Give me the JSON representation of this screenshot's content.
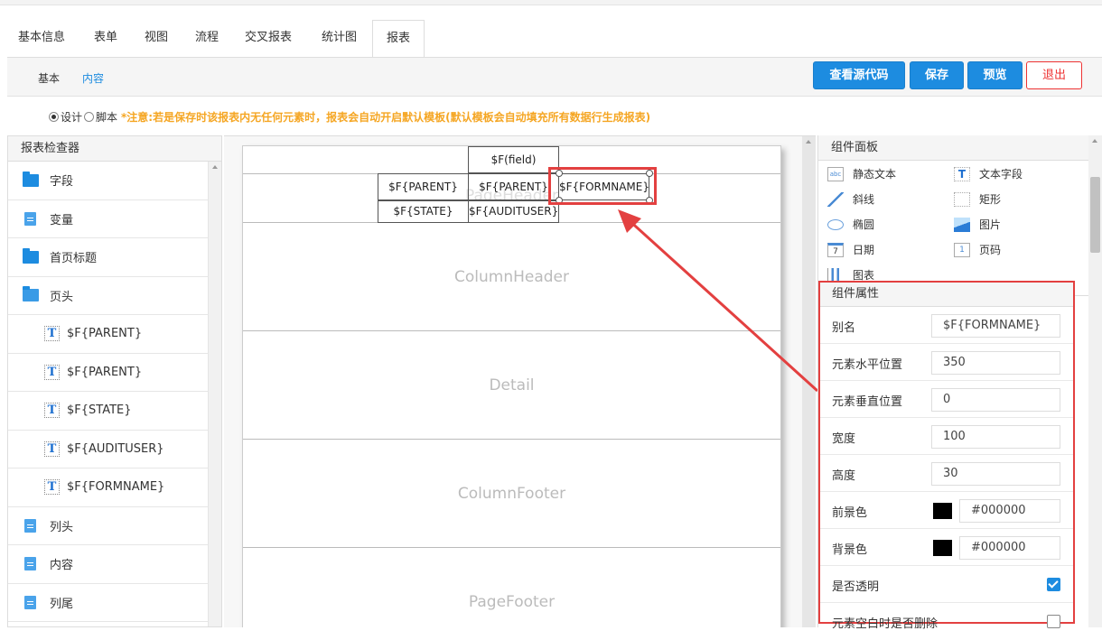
{
  "tabs": [
    {
      "label": "基本信息"
    },
    {
      "label": "表单"
    },
    {
      "label": "视图"
    },
    {
      "label": "流程"
    },
    {
      "label": "交叉报表"
    },
    {
      "label": "统计图"
    },
    {
      "label": "报表",
      "active": true
    }
  ],
  "subnav": {
    "basic": "基本",
    "content": "内容"
  },
  "buttons": {
    "view_source": "查看源代码",
    "save": "保存",
    "preview": "预览",
    "exit": "退出"
  },
  "mode": {
    "design": "设计",
    "script": "脚本",
    "selected": "设计",
    "notice": "*注意:若是保存时该报表内无任何元素时，报表会自动开启默认模板(默认模板会自动填充所有数据行生成报表)"
  },
  "inspector": {
    "title": "报表检查器",
    "items": [
      {
        "label": "字段",
        "icon": "folder-icon",
        "child": false
      },
      {
        "label": "变量",
        "icon": "document-icon",
        "child": false
      },
      {
        "label": "首页标题",
        "icon": "folder-icon",
        "child": false
      },
      {
        "label": "页头",
        "icon": "folder-open-icon",
        "child": false
      },
      {
        "label": "$F{PARENT}",
        "icon": "text-field-icon",
        "child": true
      },
      {
        "label": "$F{PARENT}",
        "icon": "text-field-icon",
        "child": true
      },
      {
        "label": "$F{STATE}",
        "icon": "text-field-icon",
        "child": true
      },
      {
        "label": "$F{AUDITUSER}",
        "icon": "text-field-icon",
        "child": true
      },
      {
        "label": "$F{FORMNAME}",
        "icon": "text-field-icon",
        "child": true
      },
      {
        "label": "列头",
        "icon": "document-icon",
        "child": false
      },
      {
        "label": "内容",
        "icon": "document-icon",
        "child": false
      },
      {
        "label": "列尾",
        "icon": "document-icon",
        "child": false
      }
    ]
  },
  "canvas": {
    "bands": {
      "page_header": "PageHeader",
      "column_header": "ColumnHeader",
      "detail": "Detail",
      "column_footer": "ColumnFooter",
      "page_footer": "PageFooter"
    },
    "cells": {
      "field": "$F(field)",
      "parent1": "$F{PARENT}",
      "parent2": "$F{PARENT}",
      "formname": "$F{FORMNAME}",
      "state": "$F{STATE}",
      "audituser": "$F{AUDITUSER}"
    }
  },
  "components": {
    "title": "组件面板",
    "items": [
      {
        "label": "静态文本",
        "icon": "static-text-icon"
      },
      {
        "label": "文本字段",
        "icon": "text-field-icon"
      },
      {
        "label": "斜线",
        "icon": "line-icon"
      },
      {
        "label": "矩形",
        "icon": "rectangle-icon"
      },
      {
        "label": "椭圆",
        "icon": "ellipse-icon"
      },
      {
        "label": "图片",
        "icon": "image-icon"
      },
      {
        "label": "日期",
        "icon": "date-icon"
      },
      {
        "label": "页码",
        "icon": "page-number-icon"
      },
      {
        "label": "图表",
        "icon": "chart-icon"
      }
    ]
  },
  "properties": {
    "title": "组件属性",
    "alias_label": "别名",
    "alias_value": "$F{FORMNAME}",
    "x_label": "元素水平位置",
    "x_value": "350",
    "y_label": "元素垂直位置",
    "y_value": "0",
    "width_label": "宽度",
    "width_value": "100",
    "height_label": "高度",
    "height_value": "30",
    "fg_label": "前景色",
    "fg_value": "#000000",
    "bg_label": "背景色",
    "bg_value": "#000000",
    "transparent_label": "是否透明",
    "transparent_checked": true,
    "remove_blank_label": "元素空白时是否删除",
    "remove_blank_checked": false
  },
  "colors": {
    "accent": "#1d8ce0",
    "highlight": "#e34040",
    "notice": "#f5a623"
  }
}
